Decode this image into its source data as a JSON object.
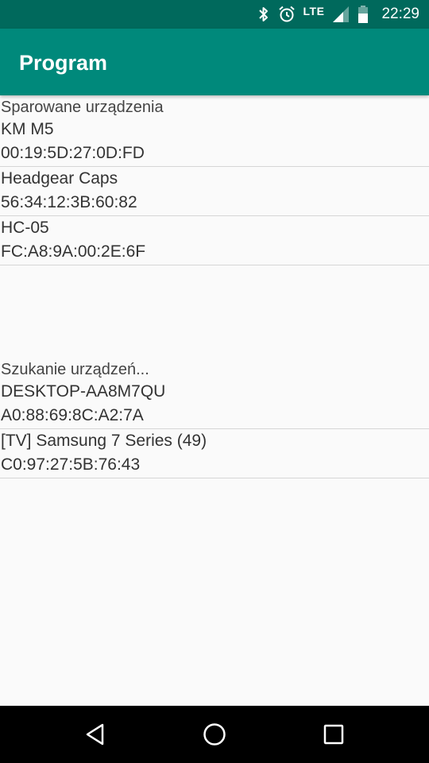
{
  "status_bar": {
    "network": "LTE",
    "time": "22:29",
    "icons": [
      "bluetooth-icon",
      "alarm-icon",
      "signal-icon",
      "battery-icon"
    ]
  },
  "app_bar": {
    "title": "Program"
  },
  "paired_section": {
    "header": "Sparowane urządzenia",
    "devices": [
      {
        "name": "KM M5",
        "address": "00:19:5D:27:0D:FD"
      },
      {
        "name": "Headgear Caps",
        "address": "56:34:12:3B:60:82"
      },
      {
        "name": "HC-05",
        "address": "FC:A8:9A:00:2E:6F"
      }
    ]
  },
  "search_section": {
    "header": "Szukanie urządzeń...",
    "devices": [
      {
        "name": "DESKTOP-AA8M7QU",
        "address": "A0:88:69:8C:A2:7A"
      },
      {
        "name": "[TV] Samsung 7 Series (49)",
        "address": "C0:97:27:5B:76:43"
      }
    ]
  },
  "nav_bar": {
    "buttons": [
      "back-icon",
      "home-icon",
      "recents-icon"
    ]
  },
  "colors": {
    "status_bar": "#00695c",
    "app_bar": "#00897b",
    "background": "#fafafa",
    "divider": "#d6d6d6"
  }
}
